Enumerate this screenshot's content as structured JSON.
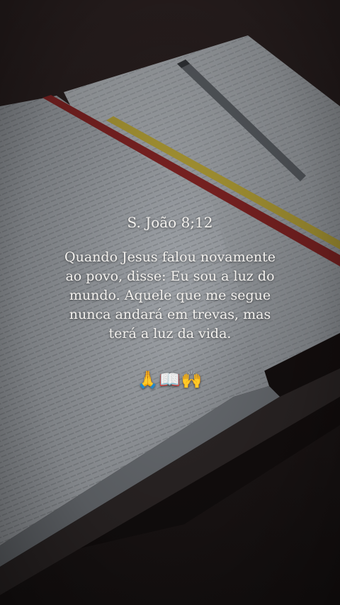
{
  "verse": {
    "reference": "S. João 8;12",
    "lines": [
      "Quando Jesus falou novamente",
      "ao povo, disse: Eu sou a luz do",
      "mundo. Aquele que me segue",
      "nunca andará em trevas, mas",
      "terá a luz da vida."
    ],
    "emojis": "🙏📖🙌"
  },
  "colors": {
    "background": "#1d1717",
    "page": "#9a9ea4",
    "ribbon_red": "#7c2222",
    "ribbon_yellow": "#a89634",
    "text": "#f3f1ee"
  }
}
